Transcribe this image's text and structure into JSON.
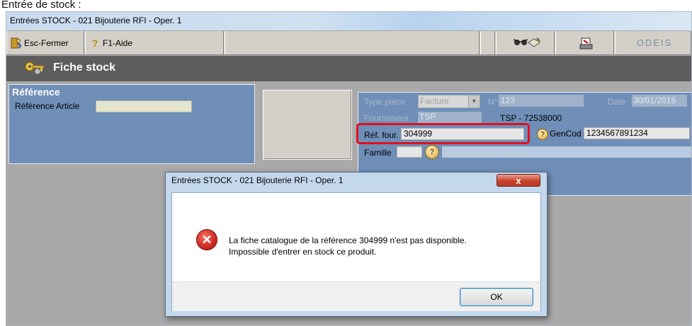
{
  "page_caption": "Entrée de stock :",
  "window": {
    "title": "Entrées STOCK - 021 Bijouterie RFI - Oper. 1"
  },
  "toolbar": {
    "close_label": "Esc-Fermer",
    "help_label": "F1-Aide",
    "brand_text": "ODEIS"
  },
  "header": {
    "title": "Fiche stock"
  },
  "reference_panel": {
    "title": "Référence",
    "article_label": "Référence Article",
    "article_value": ""
  },
  "document_panel": {
    "type_label": "Type pièce",
    "type_value": "Facture",
    "number_label": "N°",
    "number_value": "123",
    "date_label": "Date",
    "date_value": "30/01/2015",
    "supplier_label": "Fournisseur",
    "supplier_value": "TSP",
    "supplier_name": "TSP - 72538000",
    "ref_four_label": "Réf. four.",
    "ref_four_value": "304999",
    "gencod_label": "GenCod",
    "gencod_value": "1234567891234",
    "famille_label": "Famille"
  },
  "dialog": {
    "title": "Entrées STOCK - 021 Bijouterie RFI - Oper. 1",
    "close_symbol": "x",
    "message_line1": "La fiche catalogue de la référence 304999 n'est pas disponible.",
    "message_line2": "Impossible d'entrer en stock ce produit.",
    "ok_label": "OK",
    "error_symbol": "✕"
  },
  "colors": {
    "panel_blue": "#6f8fb8",
    "highlight_red": "#e0101c",
    "header_grey": "#5d5d5d"
  }
}
